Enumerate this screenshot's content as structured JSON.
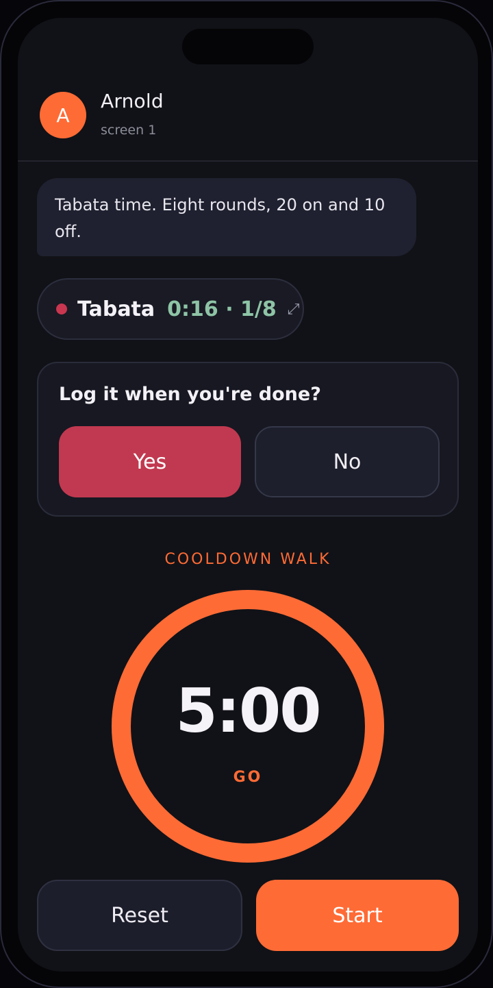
{
  "header": {
    "avatar_initial": "A",
    "contact_name": "Arnold",
    "contact_subtitle": "screen 1"
  },
  "message": {
    "text": "Tabata time. Eight rounds, 20 on and 10 off."
  },
  "timer_pill": {
    "title": "Tabata",
    "status": "0:16 · 1/8",
    "expand_icon": "expand-icon"
  },
  "log_prompt": {
    "question": "Log it when you're done?",
    "yes_label": "Yes",
    "no_label": "No"
  },
  "cooldown": {
    "phase_label": "COOLDOWN WALK",
    "time": "5:00",
    "state_label": "GO",
    "progress": 1.0
  },
  "controls": {
    "reset_label": "Reset",
    "start_label": "Start"
  },
  "colors": {
    "accent": "#ff6b35",
    "danger": "#c13950",
    "timer_green": "#8ec4a6",
    "background": "#111217"
  }
}
